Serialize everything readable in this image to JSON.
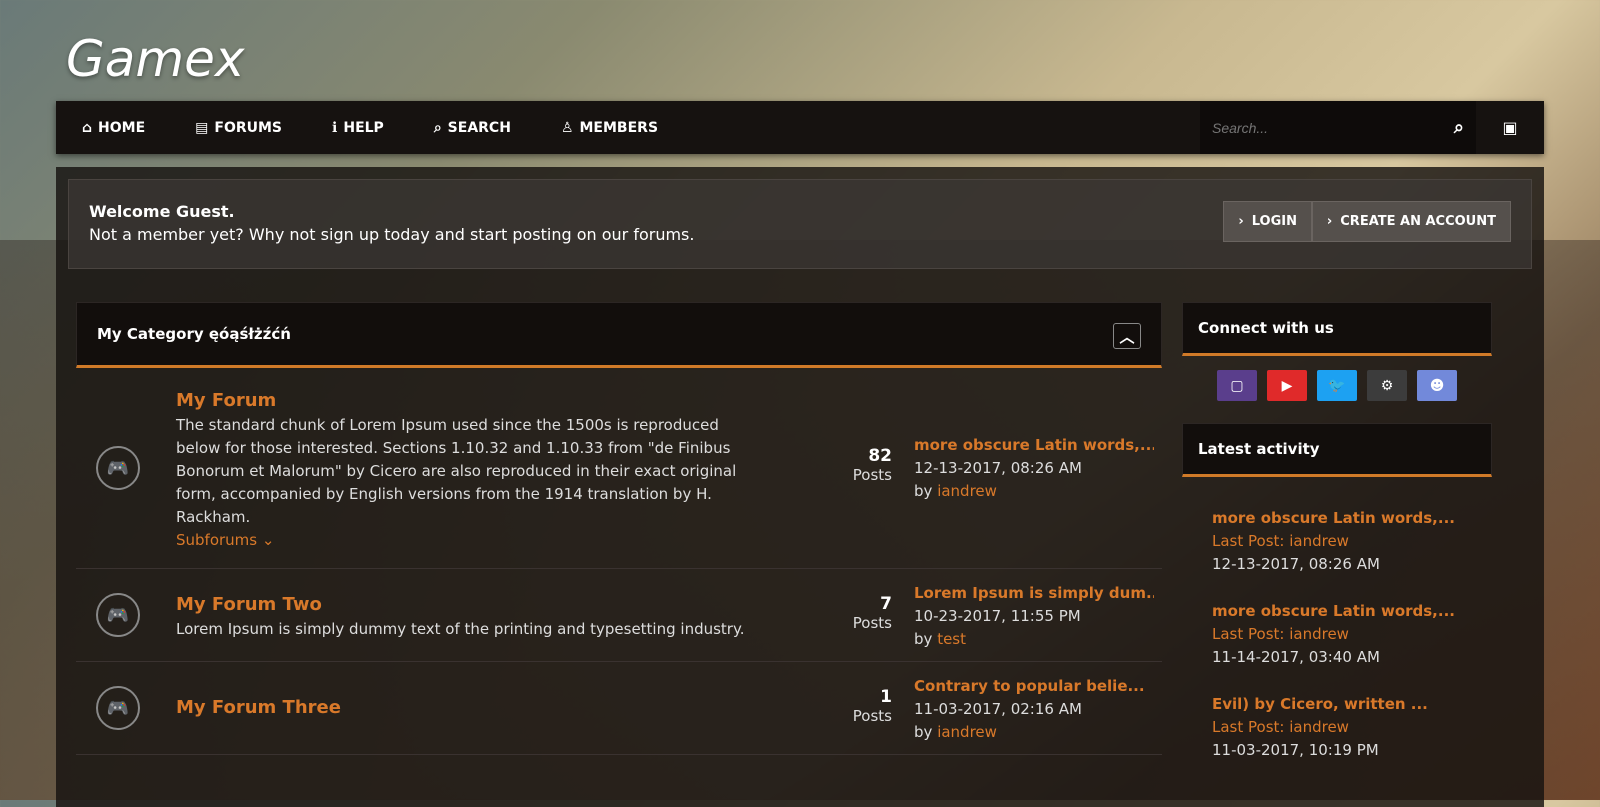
{
  "logo": "Gamex",
  "nav": [
    {
      "label": "HOME",
      "icon": "home-icon"
    },
    {
      "label": "FORUMS",
      "icon": "document-icon"
    },
    {
      "label": "HELP",
      "icon": "info-icon"
    },
    {
      "label": "SEARCH",
      "icon": "search-icon"
    },
    {
      "label": "MEMBERS",
      "icon": "user-icon"
    }
  ],
  "search": {
    "placeholder": "Search..."
  },
  "welcome": {
    "title": "Welcome Guest.",
    "text": "Not a member yet? Why not sign up today and start posting on our forums.",
    "login": "LOGIN",
    "create": "CREATE AN ACCOUNT"
  },
  "category": {
    "title": "My Category ęóąśłżźćń"
  },
  "forums": [
    {
      "title": "My Forum",
      "desc": "The standard chunk of Lorem Ipsum used since the 1500s is reproduced below for those interested. Sections 1.10.32 and 1.10.33 from \"de Finibus Bonorum et Malorum\" by Cicero are also reproduced in their exact original form, accompanied by English versions from the 1914 translation by H. Rackham.",
      "subforums": "Subforums",
      "count": "82",
      "posts": "Posts",
      "last_title": "more obscure Latin words,...",
      "last_date": "12-13-2017, 08:26 AM",
      "by": "by",
      "last_user": "iandrew"
    },
    {
      "title": "My Forum Two",
      "desc": "Lorem Ipsum is simply dummy text of the printing and typesetting industry.",
      "count": "7",
      "posts": "Posts",
      "last_title": "Lorem Ipsum is simply dum...",
      "last_date": "10-23-2017, 11:55 PM",
      "by": "by",
      "last_user": "test"
    },
    {
      "title": "My Forum Three",
      "desc": "",
      "count": "1",
      "posts": "Posts",
      "last_title": "Contrary to popular belie...",
      "last_date": "11-03-2017, 02:16 AM",
      "by": "by",
      "last_user": "iandrew"
    }
  ],
  "sidebar": {
    "connect": "Connect with us",
    "social": [
      {
        "name": "twitch",
        "color": "#5a3e8c"
      },
      {
        "name": "youtube",
        "color": "#e02a2a"
      },
      {
        "name": "twitter",
        "color": "#1da1f2"
      },
      {
        "name": "steam",
        "color": "#3c3c3c"
      },
      {
        "name": "discord",
        "color": "#7289da"
      }
    ],
    "latest": "Latest activity",
    "activity": [
      {
        "title": "more obscure Latin words,...",
        "last": "Last Post: iandrew",
        "date": "12-13-2017, 08:26 AM"
      },
      {
        "title": "more obscure Latin words,...",
        "last": "Last Post: iandrew",
        "date": "11-14-2017, 03:40 AM"
      },
      {
        "title": "Evil) by Cicero, written ...",
        "last": "Last Post: iandrew",
        "date": "11-03-2017, 10:19 PM"
      }
    ]
  }
}
